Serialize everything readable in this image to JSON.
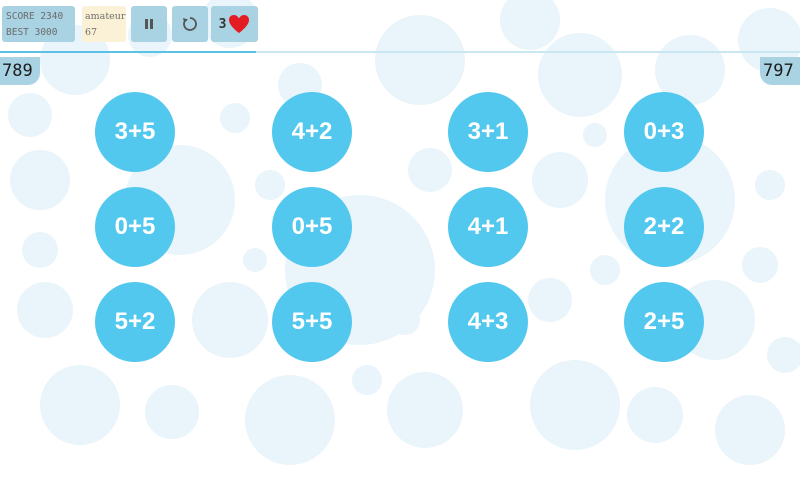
{
  "hud": {
    "score_label": "SCORE 2340",
    "best_label": "BEST 3000",
    "level_name": "amateur",
    "level_value": "67",
    "lives": "3"
  },
  "progress": 0.32,
  "corners": {
    "left": "789",
    "right": "797"
  },
  "equations": [
    [
      "3+5",
      "4+2",
      "3+1",
      "0+3"
    ],
    [
      "0+5",
      "0+5",
      "4+1",
      "2+2"
    ],
    [
      "5+2",
      "5+5",
      "4+3",
      "2+5"
    ]
  ],
  "colors": {
    "bubble": "#53c8ee",
    "hud": "#a9d3e3",
    "level_bg": "#fbf1d6",
    "background_circles": "#e7f4f9",
    "heart": "#e31b23"
  },
  "icons": {
    "pause": "pause-icon",
    "restart": "restart-icon",
    "lives": "heart-icon"
  }
}
